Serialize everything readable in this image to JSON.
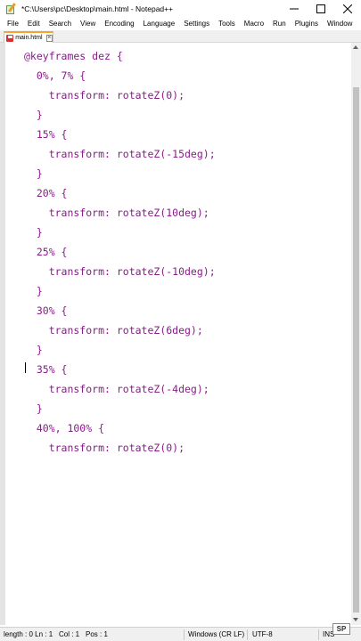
{
  "window": {
    "title": "*C:\\Users\\pc\\Desktop\\main.html - Notepad++",
    "controls": [
      "minimize",
      "maximize",
      "close"
    ]
  },
  "menu": [
    "File",
    "Edit",
    "Search",
    "View",
    "Encoding",
    "Language",
    "Settings",
    "Tools",
    "Macro",
    "Run",
    "Plugins",
    "Window"
  ],
  "tabs": [
    {
      "label": "main.html",
      "modified": true
    }
  ],
  "editor": {
    "lines": [
      "@keyframes dez {",
      "  0%, 7% {",
      "    transform: rotateZ(0);",
      "  }",
      "  15% {",
      "    transform: rotateZ(-15deg);",
      "  }",
      "  20% {",
      "    transform: rotateZ(10deg);",
      "  }",
      "  25% {",
      "    transform: rotateZ(-10deg);",
      "  }",
      "  30% {",
      "    transform: rotateZ(6deg);",
      "  }",
      "  35% {",
      "    transform: rotateZ(-4deg);",
      "  }",
      "  40%, 100% {",
      "    transform: rotateZ(0);",
      ""
    ],
    "text_color": "#8a1a8a"
  },
  "status": {
    "length_lines": "length : 0 Ln : 1",
    "col": "Col : 1",
    "pos": "Pos : 1",
    "eol": "Windows (CR LF)",
    "encoding": "UTF-8",
    "mode": "INS"
  },
  "watermark": "SP",
  "colors": {
    "tab_accent": "#f4a430",
    "code": "#8a1a8a"
  }
}
